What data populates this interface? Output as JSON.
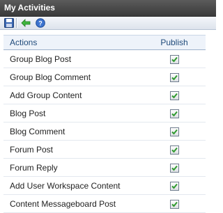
{
  "window": {
    "title": "My Activities"
  },
  "toolbar": {
    "icons": [
      "save-icon",
      "back-arrow-icon",
      "help-icon"
    ]
  },
  "table": {
    "headers": {
      "actions": "Actions",
      "publish": "Publish"
    },
    "rows": [
      {
        "action": "Group Blog Post",
        "publish": true
      },
      {
        "action": "Group Blog Comment",
        "publish": true
      },
      {
        "action": "Add Group Content",
        "publish": true
      },
      {
        "action": "Blog Post",
        "publish": true
      },
      {
        "action": "Blog Comment",
        "publish": true
      },
      {
        "action": "Forum Post",
        "publish": true
      },
      {
        "action": "Forum Reply",
        "publish": true
      },
      {
        "action": "Add User Workspace Content",
        "publish": true
      },
      {
        "action": "Content Messageboard Post",
        "publish": true
      }
    ]
  },
  "colors": {
    "check": "#2f9a2f",
    "header_text": "#1f4a7a"
  }
}
